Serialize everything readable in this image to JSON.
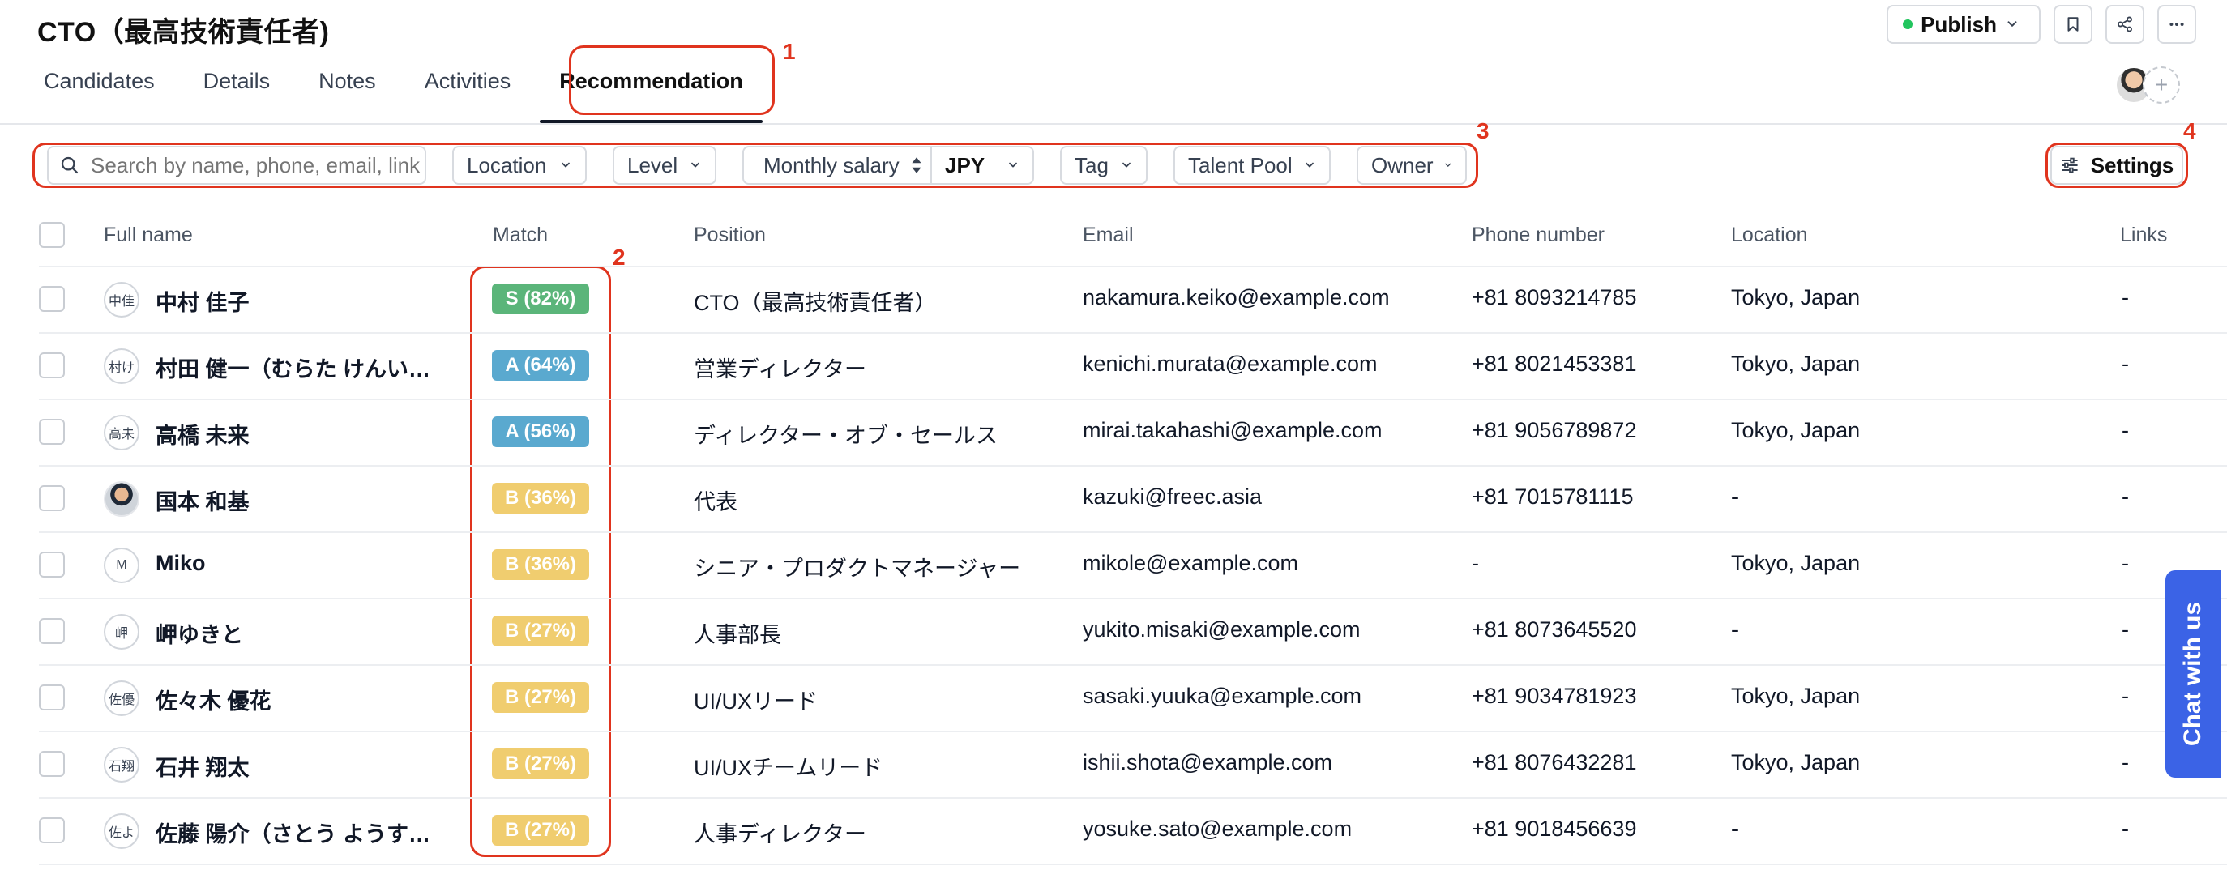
{
  "header": {
    "title": "CTO（最高技術責任者)",
    "publish_label": "Publish"
  },
  "tabs": [
    "Candidates",
    "Details",
    "Notes",
    "Activities",
    "Recommendation"
  ],
  "filters": {
    "search_placeholder": "Search by name, phone, email, link",
    "location": "Location",
    "level": "Level",
    "monthly_salary": "Monthly salary",
    "currency": "JPY",
    "tag": "Tag",
    "talent_pool": "Talent Pool",
    "owner": "Owner",
    "settings": "Settings"
  },
  "annotations": [
    "1",
    "2",
    "3",
    "4"
  ],
  "table": {
    "headers": [
      "Full name",
      "Match",
      "Position",
      "Email",
      "Phone number",
      "Location",
      "Links"
    ],
    "rows": [
      {
        "initials": "中佳",
        "name": "中村 佳子",
        "match": "S (82%)",
        "grade": "S",
        "position": "CTO（最高技術責任者）",
        "email": "nakamura.keiko@example.com",
        "phone": "+81 8093214785",
        "location": "Tokyo, Japan",
        "links": "-"
      },
      {
        "initials": "村け",
        "name": "村田 健一（むらた けんいち...",
        "match": "A (64%)",
        "grade": "A",
        "position": "営業ディレクター",
        "email": "kenichi.murata@example.com",
        "phone": "+81 8021453381",
        "location": "Tokyo, Japan",
        "links": "-"
      },
      {
        "initials": "高未",
        "name": "高橋 未来",
        "match": "A (56%)",
        "grade": "A",
        "position": "ディレクター・オブ・セールス",
        "email": "mirai.takahashi@example.com",
        "phone": "+81 9056789872",
        "location": "Tokyo, Japan",
        "links": "-"
      },
      {
        "initials": "",
        "name": "国本 和基",
        "match": "B (36%)",
        "grade": "B",
        "position": "代表",
        "email": "kazuki@freec.asia",
        "phone": "+81 7015781115",
        "location": "-",
        "links": "-"
      },
      {
        "initials": "M",
        "name": "Miko",
        "match": "B (36%)",
        "grade": "B",
        "position": "シニア・プロダクトマネージャー",
        "email": "mikole@example.com",
        "phone": "-",
        "location": "Tokyo, Japan",
        "links": "-"
      },
      {
        "initials": "岬",
        "name": "岬ゆきと",
        "match": "B (27%)",
        "grade": "B",
        "position": "人事部長",
        "email": "yukito.misaki@example.com",
        "phone": "+81 8073645520",
        "location": "-",
        "links": "-"
      },
      {
        "initials": "佐優",
        "name": "佐々木 優花",
        "match": "B (27%)",
        "grade": "B",
        "position": "UI/UXリード",
        "email": "sasaki.yuuka@example.com",
        "phone": "+81 9034781923",
        "location": "Tokyo, Japan",
        "links": "-"
      },
      {
        "initials": "石翔",
        "name": "石井 翔太",
        "match": "B (27%)",
        "grade": "B",
        "position": "UI/UXチームリード",
        "email": "ishii.shota@example.com",
        "phone": "+81 8076432281",
        "location": "Tokyo, Japan",
        "links": "-"
      },
      {
        "initials": "佐よ",
        "name": "佐藤 陽介（さとう ようすけ...",
        "match": "B (27%)",
        "grade": "B",
        "position": "人事ディレクター",
        "email": "yosuke.sato@example.com",
        "phone": "+81 9018456639",
        "location": "-",
        "links": "-"
      }
    ]
  },
  "chat_label": "Chat with us",
  "colors": {
    "annotation": "#e0341e",
    "grade_S": "#5bb57a",
    "grade_A": "#5aa9cf",
    "grade_B": "#f0cd6f",
    "chat": "#3b63e6"
  }
}
